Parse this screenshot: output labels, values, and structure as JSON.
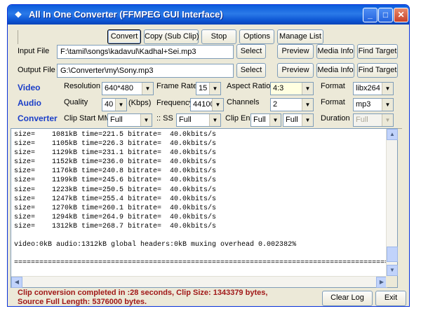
{
  "window": {
    "title": "All In One Converter (FFMPEG GUI Interface)",
    "min_glyph": "_",
    "max_glyph": "□",
    "close_glyph": "✕"
  },
  "toolbar": {
    "convert": "Convert",
    "copy_sub_clip": "Copy (Sub Clip)",
    "stop": "Stop",
    "options": "Options",
    "manage_list": "Manage List"
  },
  "input": {
    "label": "Input File",
    "value": "F:\\tamil\\songs\\kadavul\\Kadhal+Sei.mp3",
    "select": "Select",
    "preview": "Preview",
    "media_info": "Media Info",
    "find_target": "Find Target"
  },
  "output": {
    "label": "Output File",
    "value": "G:\\Converter\\my\\Sony.mp3",
    "select": "Select",
    "preview": "Preview",
    "media_info": "Media Info",
    "find_target": "Find Target"
  },
  "video": {
    "section": "Video",
    "resolution_label": "Resolution",
    "resolution": "640*480",
    "frame_rate_label": "Frame Rate",
    "frame_rate": "15",
    "aspect_label": "Aspect Ratio",
    "aspect": "4:3",
    "format_label": "Format",
    "format": "libx264"
  },
  "audio": {
    "section": "Audio",
    "quality_label": "Quality",
    "quality": "40",
    "quality_unit": "(Kbps)",
    "frequency_label": "Frequency",
    "frequency": "44100",
    "channels_label": "Channels",
    "channels": "2",
    "format_label": "Format",
    "format": "mp3"
  },
  "converter": {
    "section": "Converter",
    "clip_start_label": "Clip Start MM",
    "clip_start_mm": "Full",
    "ss_label": ":: SS",
    "ss": "Full",
    "clip_end_label": "Clip End",
    "clip_end_1": "Full",
    "clip_end_2": "Full",
    "duration_label": "Duration",
    "duration": "Full"
  },
  "log": {
    "lines": [
      "size=    1081kB time=221.5 bitrate=  40.0kbits/s",
      "size=    1105kB time=226.3 bitrate=  40.0kbits/s",
      "size=    1129kB time=231.1 bitrate=  40.0kbits/s",
      "size=    1152kB time=236.0 bitrate=  40.0kbits/s",
      "size=    1176kB time=240.8 bitrate=  40.0kbits/s",
      "size=    1199kB time=245.6 bitrate=  40.0kbits/s",
      "size=    1223kB time=250.5 bitrate=  40.0kbits/s",
      "size=    1247kB time=255.4 bitrate=  40.0kbits/s",
      "size=    1270kB time=260.1 bitrate=  40.0kbits/s",
      "size=    1294kB time=264.9 bitrate=  40.0kbits/s",
      "size=    1312kB time=268.7 bitrate=  40.0kbits/s",
      "",
      "video:0kB audio:1312kB global headers:0kB muxing overhead 0.002382%",
      "",
      "====================================================================================================="
    ]
  },
  "status": {
    "line1": "Clip conversion completed in  :28 seconds, Clip Size: 1343379 bytes,",
    "line2": "Source Full Length: 5376000 bytes."
  },
  "footer": {
    "clear_log": "Clear Log",
    "exit": "Exit"
  },
  "icons": {
    "dropdown": "▼",
    "scroll_up": "▲",
    "scroll_down": "▼",
    "scroll_left": "◀",
    "scroll_right": "▶",
    "app": "❖"
  }
}
